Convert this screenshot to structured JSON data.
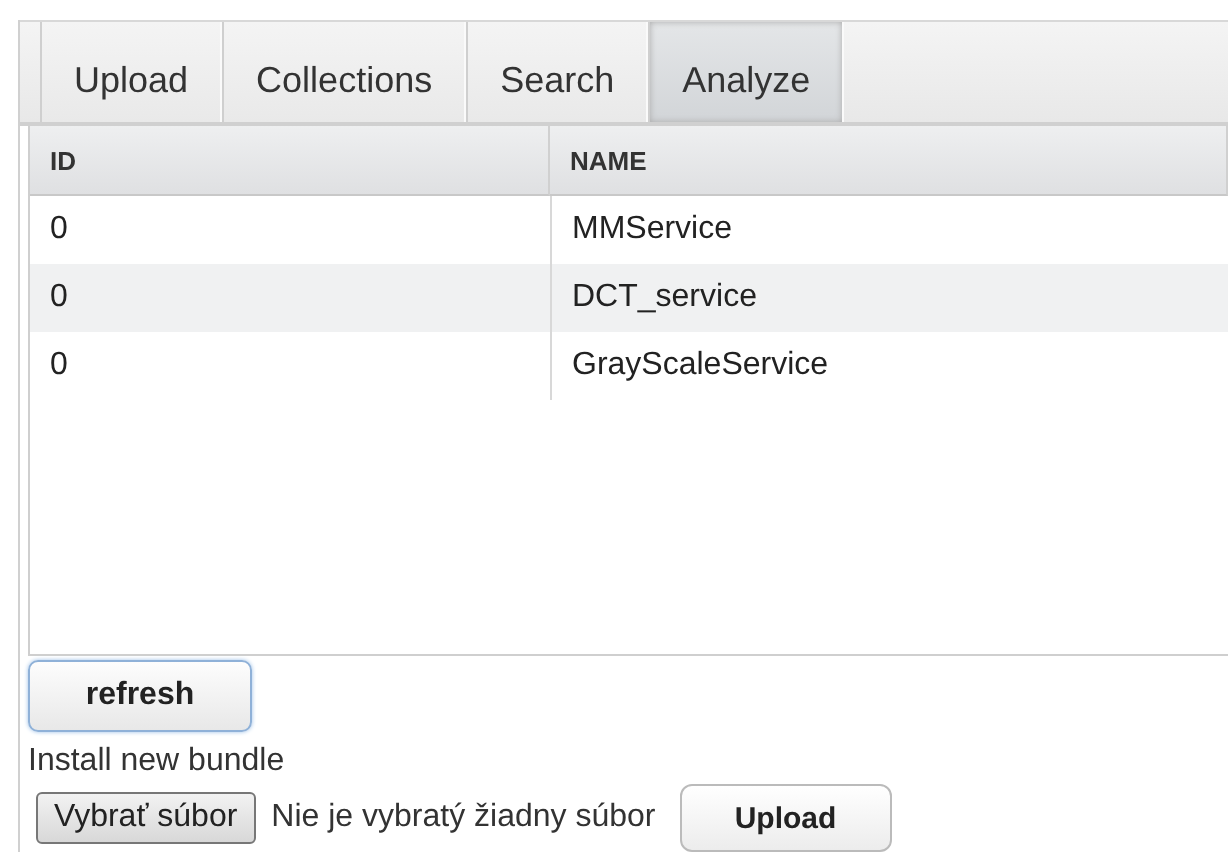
{
  "tabs": [
    {
      "label": "Upload",
      "selected": false
    },
    {
      "label": "Collections",
      "selected": false
    },
    {
      "label": "Search",
      "selected": false
    },
    {
      "label": "Analyze",
      "selected": true
    }
  ],
  "table": {
    "columns": [
      "ID",
      "NAME"
    ],
    "rows": [
      [
        "0",
        "MMService"
      ],
      [
        "0",
        "DCT_service"
      ],
      [
        "0",
        "GrayScaleService"
      ]
    ]
  },
  "refresh_button": "refresh",
  "install_label": "Install new bundle",
  "file_input": {
    "button": "Vybrať súbor",
    "status": "Nie je vybratý žiadny súbor"
  },
  "upload_button": "Upload"
}
